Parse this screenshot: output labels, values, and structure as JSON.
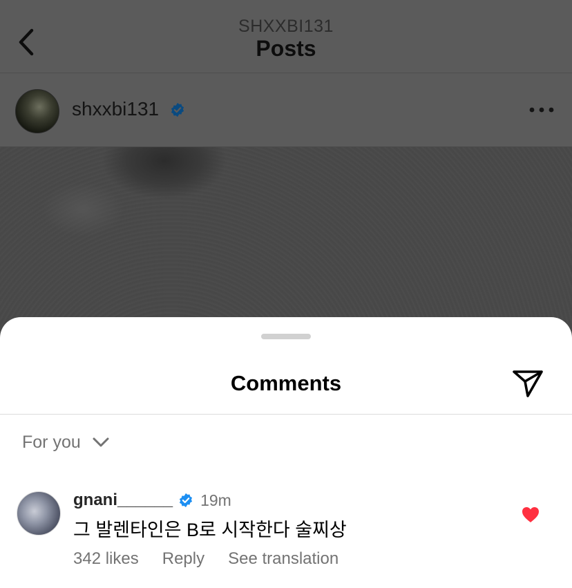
{
  "header": {
    "account": "SHXXBI131",
    "title": "Posts"
  },
  "post": {
    "username": "shxxbi131",
    "verified": true
  },
  "comments_sheet": {
    "title": "Comments",
    "filter_label": "For you",
    "comments": [
      {
        "username": "gnani______",
        "verified": true,
        "time": "19m",
        "text": "그 발렌타인은 B로 시작한다 술찌상",
        "likes": "342 likes",
        "reply_label": "Reply",
        "translate_label": "See translation",
        "liked": true
      }
    ]
  },
  "colors": {
    "verified_blue": "#1d8ff2",
    "heart_red": "#ff3040",
    "dim_overlay": "#5b5b5b"
  },
  "icons": [
    "back-arrow-icon",
    "verified-badge-icon",
    "more-options-icon",
    "share-send-icon",
    "chevron-down-icon",
    "heart-icon"
  ]
}
